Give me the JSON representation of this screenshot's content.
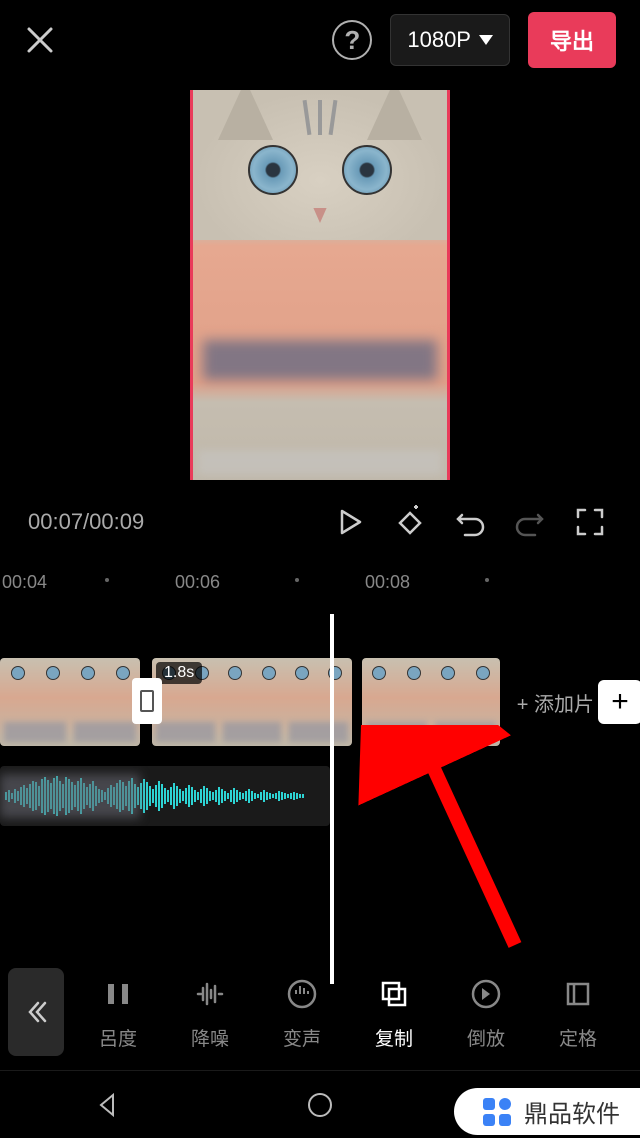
{
  "header": {
    "resolution": "1080P",
    "export": "导出"
  },
  "time": {
    "current": "00:07",
    "total": "00:09",
    "display": "00:07/00:09"
  },
  "ruler": {
    "t1": "00:04",
    "t2": "00:06",
    "t3": "00:08"
  },
  "clip": {
    "duration": "1.8s"
  },
  "timeline": {
    "add_clip": "+ 添加片"
  },
  "tools": {
    "t1": "呂度",
    "t2": "降噪",
    "t3": "变声",
    "t4": "复制",
    "t5": "倒放",
    "t6": "定格"
  },
  "watermark": {
    "text": "鼎品软件"
  }
}
